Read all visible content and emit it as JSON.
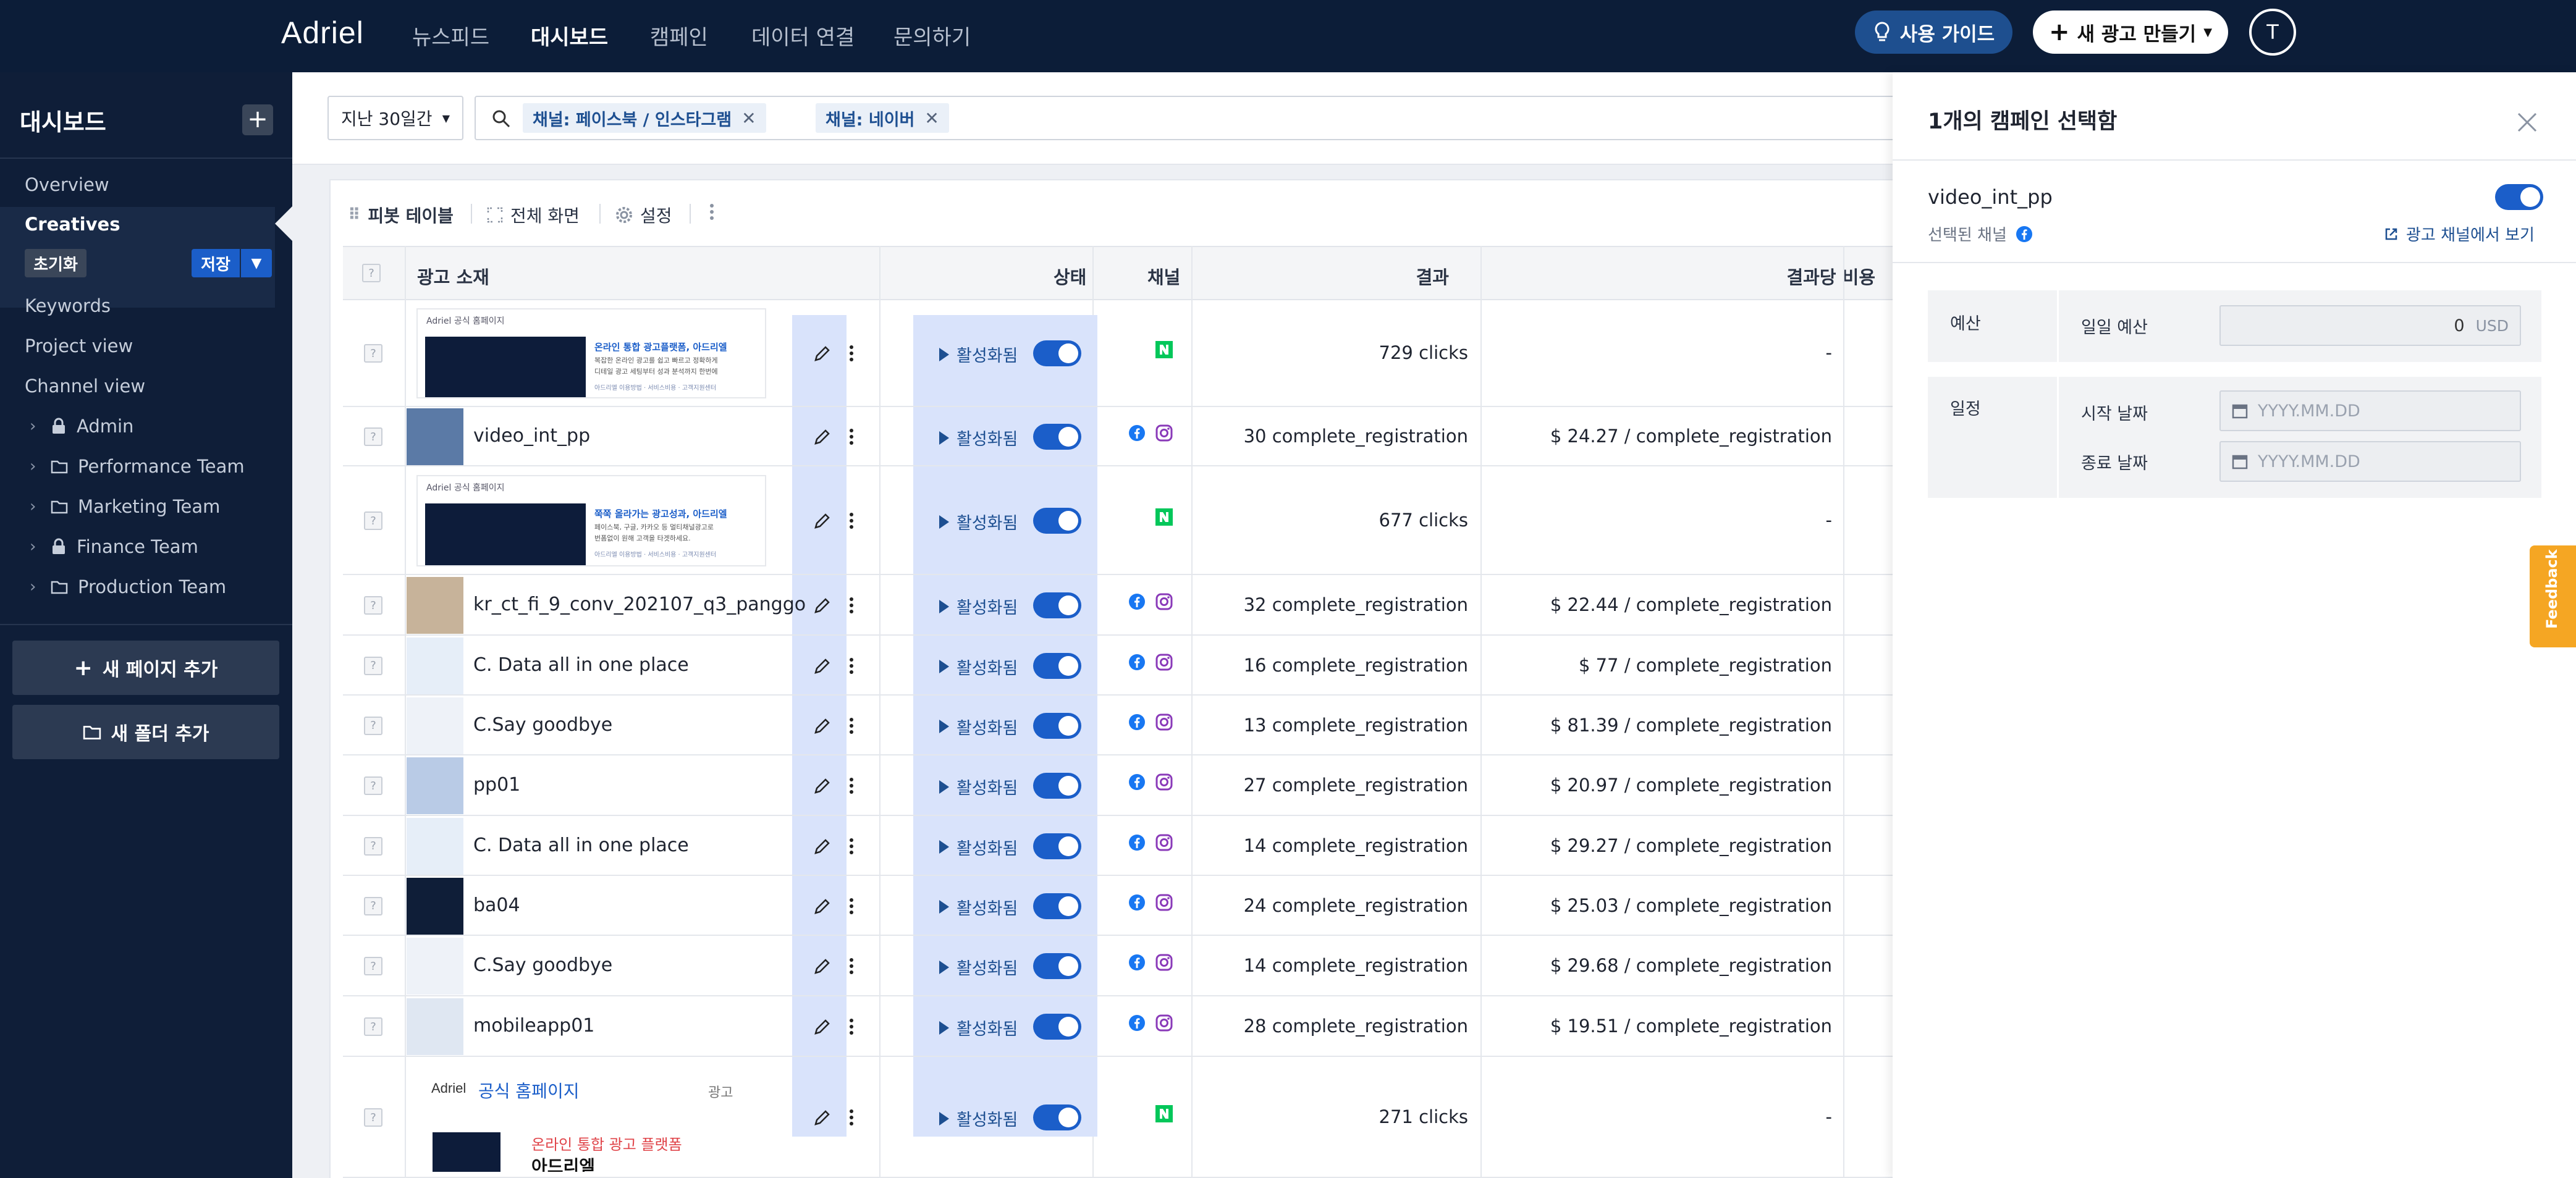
{
  "header": {
    "logo": "Adriel",
    "nav": [
      "뉴스피드",
      "대시보드",
      "캠페인",
      "데이터 연결",
      "문의하기"
    ],
    "active_nav": "대시보드",
    "guide_label": "사용 가이드",
    "new_ad_label": "새 광고 만들기",
    "avatar_initial": "T"
  },
  "sidebar": {
    "title": "대시보드",
    "add_label": "+",
    "items": [
      "Overview",
      "Creatives",
      "Keywords",
      "Project view",
      "Channel view"
    ],
    "active_item": "Creatives",
    "reset_label": "초기화",
    "save_label": "저장",
    "folders": [
      {
        "name": "Admin",
        "type": "lock"
      },
      {
        "name": "Performance Team",
        "type": "folder"
      },
      {
        "name": "Marketing Team",
        "type": "folder"
      },
      {
        "name": "Finance Team",
        "type": "lock"
      },
      {
        "name": "Production Team",
        "type": "folder"
      }
    ],
    "add_page_label": "새 페이지 추가",
    "add_folder_label": "새 폴더 추가"
  },
  "filters": {
    "period": "지난 30일간",
    "chips": [
      "채널: 페이스북 / 인스타그램",
      "채널: 네이버"
    ]
  },
  "toolbar": {
    "pivot": "피봇 테이블",
    "fullscreen": "전체 화면",
    "settings": "설정"
  },
  "table": {
    "headers": {
      "creative": "광고 소재",
      "status": "상태",
      "channel": "채널",
      "result": "결과",
      "cost": "결과당 비용"
    },
    "qmark": "?",
    "rows": [
      {
        "name": "",
        "preview": "naver_ad_1",
        "status": "활성화됨",
        "channels": [
          "naver"
        ],
        "result": "729 clicks",
        "cost": "-"
      },
      {
        "name": "video_int_pp",
        "status": "활성화됨",
        "channels": [
          "facebook",
          "instagram"
        ],
        "result": "30 complete_registration",
        "cost": "$ 24.27 / complete_registration"
      },
      {
        "name": "",
        "preview": "naver_ad_2",
        "status": "활성화됨",
        "channels": [
          "naver"
        ],
        "result": "677 clicks",
        "cost": "-"
      },
      {
        "name": "kr_ct_fi_9_conv_202107_q3_panggo",
        "status": "활성화됨",
        "channels": [
          "facebook",
          "instagram"
        ],
        "result": "32 complete_registration",
        "cost": "$ 22.44 / complete_registration"
      },
      {
        "name": "C. Data all in one place",
        "status": "활성화됨",
        "channels": [
          "facebook",
          "instagram"
        ],
        "result": "16 complete_registration",
        "cost": "$ 77 / complete_registration"
      },
      {
        "name": "C.Say goodbye",
        "status": "활성화됨",
        "channels": [
          "facebook",
          "instagram"
        ],
        "result": "13 complete_registration",
        "cost": "$ 81.39 / complete_registration"
      },
      {
        "name": "pp01",
        "status": "활성화됨",
        "channels": [
          "facebook",
          "instagram"
        ],
        "result": "27 complete_registration",
        "cost": "$ 20.97 / complete_registration"
      },
      {
        "name": "C. Data all in one place",
        "status": "활성화됨",
        "channels": [
          "facebook",
          "instagram"
        ],
        "result": "14 complete_registration",
        "cost": "$ 29.27 / complete_registration"
      },
      {
        "name": "ba04",
        "status": "활성화됨",
        "channels": [
          "facebook",
          "instagram"
        ],
        "result": "24 complete_registration",
        "cost": "$ 25.03 / complete_registration"
      },
      {
        "name": "C.Say goodbye",
        "status": "활성화됨",
        "channels": [
          "facebook",
          "instagram"
        ],
        "result": "14 complete_registration",
        "cost": "$ 29.68 / complete_registration"
      },
      {
        "name": "mobileapp01",
        "status": "활성화됨",
        "channels": [
          "facebook",
          "instagram"
        ],
        "result": "28 complete_registration",
        "cost": "$ 19.51 / complete_registration"
      },
      {
        "name": "",
        "preview": "naver_ad_3",
        "status": "활성화됨",
        "channels": [
          "naver"
        ],
        "result": "271 clicks",
        "cost": "-"
      }
    ]
  },
  "ad_previews": {
    "naver_ad_1": {
      "header": "Adriel 공식 홈페이지",
      "title": "온라인 통합 광고플랫폼, 아드리엘",
      "desc": "복잡한 온라인 광고를 쉽고 빠르고 정확하게",
      "desc2": "디테일 광고 세팅부터 성과 분석까지 한번에",
      "links": "아드리엘 이용방법 · 서비스비용 · 고객지원센터"
    },
    "naver_ad_2": {
      "header": "Adriel 공식 홈페이지",
      "title": "쭉쭉 올라가는 광고성과, 아드리엘",
      "desc": "페이스북, 구글, 카카오 등 멀티채널광고로",
      "desc2": "번폼없이 원해 고객을 타겟하세요.",
      "links": "아드리엘 이용방법 · 서비스비용 · 고객지원센터"
    },
    "naver_ad_3": {
      "header_brand": "Adriel",
      "header": "공식 홈페이지",
      "ad_tag": "광고",
      "title": "온라인 통합 광고 플랫폼",
      "title2": "아드리엘"
    }
  },
  "panel": {
    "title": "1개의 캠페인 선택함",
    "campaign_name": "video_int_pp",
    "selected_channel_label": "선택된 채널",
    "view_link": "광고 채널에서 보기",
    "budget_label": "예산",
    "daily_budget_label": "일일 예산",
    "daily_budget_value": "0",
    "currency": "USD",
    "schedule_label": "일정",
    "start_label": "시작 날짜",
    "end_label": "종료 날짜",
    "date_placeholder": "YYYY.MM.DD"
  },
  "feedback_label": "Feedback",
  "colors": {
    "navy": "#0c1d38",
    "accent": "#1b5ec9",
    "naver": "#03c75a",
    "facebook": "#1877f2",
    "instagram": "#8a3ab9",
    "feedback": "#f5a623"
  }
}
